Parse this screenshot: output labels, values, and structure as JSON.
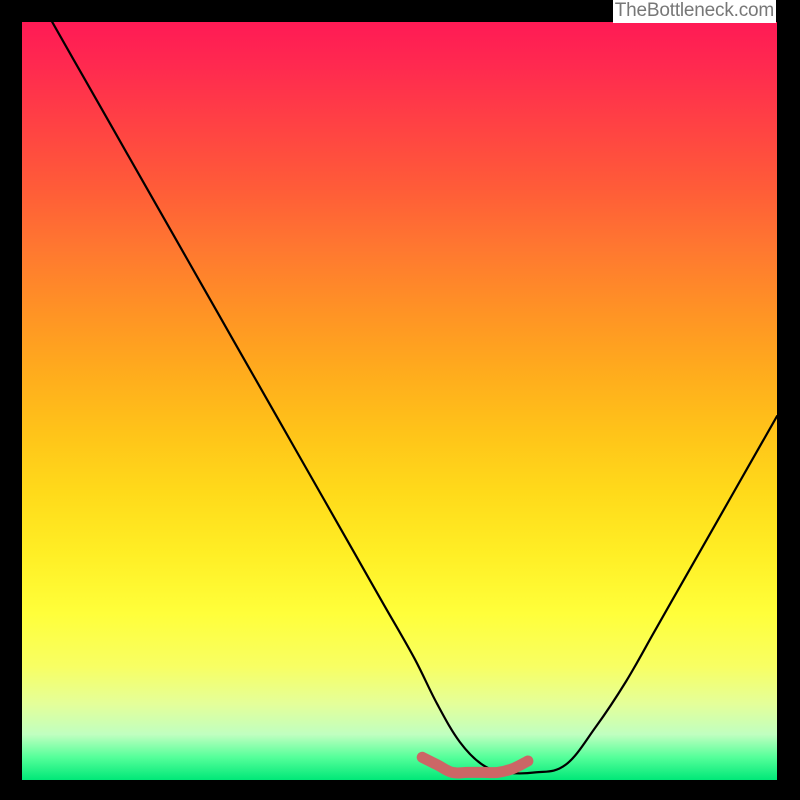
{
  "watermark": "TheBottleneck.com",
  "colors": {
    "frame": "#000000",
    "curve": "#000000",
    "marker": "#cc6666",
    "gradient_top": "#ff1a55",
    "gradient_bottom": "#00e878"
  },
  "chart_data": {
    "type": "line",
    "title": "",
    "xlabel": "",
    "ylabel": "",
    "x_range": [
      0,
      100
    ],
    "y_range": [
      0,
      100
    ],
    "grid": false,
    "legend": false,
    "annotations": [
      "TheBottleneck.com"
    ],
    "series": [
      {
        "name": "bottleneck-curve",
        "x": [
          4,
          8,
          12,
          16,
          20,
          24,
          28,
          32,
          36,
          40,
          44,
          48,
          52,
          55,
          58,
          61,
          64,
          68,
          72,
          76,
          80,
          84,
          88,
          92,
          96,
          100
        ],
        "y": [
          100,
          93,
          86,
          79,
          72,
          65,
          58,
          51,
          44,
          37,
          30,
          23,
          16,
          10,
          5,
          2,
          1,
          1,
          2,
          7,
          13,
          20,
          27,
          34,
          41,
          48
        ]
      },
      {
        "name": "optimal-flat-region",
        "x": [
          53,
          55,
          57,
          59,
          61,
          63,
          65,
          67
        ],
        "y": [
          3,
          2,
          1,
          1,
          1,
          1,
          1.5,
          2.5
        ]
      }
    ],
    "note": "Axes are unlabeled in the source image; x/y values are read off the plot as percentages of the visible area, with y=0 at the bottom (green) edge and y=100 at the top (red) edge."
  }
}
